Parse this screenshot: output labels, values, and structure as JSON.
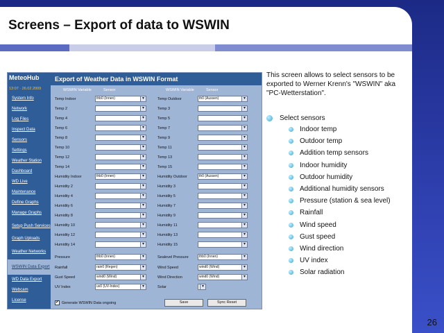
{
  "slide": {
    "title": "Screens – Export of data to WSWIN",
    "page_number": "26",
    "description": "This screen allows to select sensors to be exported to Werner Krenn's \"WSWIN\" aka \"PC-Wetterstation\".",
    "bullet": "Select sensors",
    "sub_bullets": [
      "Indoor temp",
      "Outdoor temp",
      "Addition temp sensors",
      "Indoor humidity",
      "Outdoor humidity",
      "Additional humidity sensors",
      "Pressure (station & sea level)",
      "Rainfall",
      "Wind speed",
      "Gust speed",
      "Wind direction",
      "UV index",
      "Solar radiation"
    ]
  },
  "screenshot": {
    "logo": "MeteoHub",
    "date": "13:07 · 26.02.2009",
    "header": "Export of Weather Data in WSWIN Format",
    "sidebar": [
      "System Info",
      "Network",
      "Log Files",
      "Inspect Data",
      "Sensors",
      "Settings",
      "Weather Station",
      "Dashboard",
      "WD Live",
      "Maintenance",
      "Define Graphs",
      "Manage Graphs",
      "Setup Push Services",
      "Graph Uploads",
      "Weather Networks",
      "WSWIN Data Export",
      "WD Data Export",
      "Webcam",
      "License"
    ],
    "columns": {
      "var1": "WSWIN Variable",
      "sensor1": "Sensor",
      "var2": "WSWIN Variable",
      "sensor2": "Sensor"
    },
    "rows": [
      {
        "l1": "Temp Indoor",
        "v1": "thb0 (Innen)",
        "l2": "Temp Outdoor",
        "v2": "th0 (Aussen)"
      },
      {
        "l1": "Temp 2",
        "v1": "",
        "l2": "Temp 3",
        "v2": ""
      },
      {
        "l1": "Temp 4",
        "v1": "",
        "l2": "Temp 5",
        "v2": ""
      },
      {
        "l1": "Temp 6",
        "v1": "",
        "l2": "Temp 7",
        "v2": ""
      },
      {
        "l1": "Temp 8",
        "v1": "",
        "l2": "Temp 9",
        "v2": ""
      },
      {
        "l1": "Temp 10",
        "v1": "",
        "l2": "Temp 11",
        "v2": ""
      },
      {
        "l1": "Temp 12",
        "v1": "",
        "l2": "Temp 13",
        "v2": ""
      },
      {
        "l1": "Temp 14",
        "v1": "",
        "l2": "Temp 15",
        "v2": ""
      },
      {
        "l1": "Humidity Indoor",
        "v1": "thb0 (Innen)",
        "l2": "Humidity Outdoor",
        "v2": "th0 (Aussen)"
      },
      {
        "l1": "Humidity 2",
        "v1": "",
        "l2": "Humidity 3",
        "v2": ""
      },
      {
        "l1": "Humidity 4",
        "v1": "",
        "l2": "Humidity 5",
        "v2": ""
      },
      {
        "l1": "Humidity 6",
        "v1": "",
        "l2": "Humidity 7",
        "v2": ""
      },
      {
        "l1": "Humidity 8",
        "v1": "",
        "l2": "Humidity 9",
        "v2": ""
      },
      {
        "l1": "Humidity 10",
        "v1": "",
        "l2": "Humidity 11",
        "v2": ""
      },
      {
        "l1": "Humidity 12",
        "v1": "",
        "l2": "Humidity 13",
        "v2": ""
      },
      {
        "l1": "Humidity 14",
        "v1": "",
        "l2": "Humidity 15",
        "v2": ""
      }
    ],
    "pressure": {
      "l1": "Pressure",
      "v1": "thb0 (Innen)",
      "l2": "Sealevel Pressure",
      "v2": "thb0 (Innen)"
    },
    "rainfall": {
      "l1": "Rainfall",
      "v1": "rain0 (Regen)",
      "l2": "Wind Speed",
      "v2": "wind0 (Wind)"
    },
    "gust": {
      "l1": "Gust Speed",
      "v1": "wind0 (Wind)",
      "l2": "Wind Direction",
      "v2": "wind0 (Wind)"
    },
    "uv": {
      "l1": "UV Index",
      "v1": "uv0 (UV-Index)",
      "l2": "Solar",
      "v2": ""
    },
    "checkbox_label": "Generate WSWIN Data ongoing",
    "checkbox_mark": "✔",
    "save_label": "Save",
    "sync_label": "Sync Reset"
  }
}
